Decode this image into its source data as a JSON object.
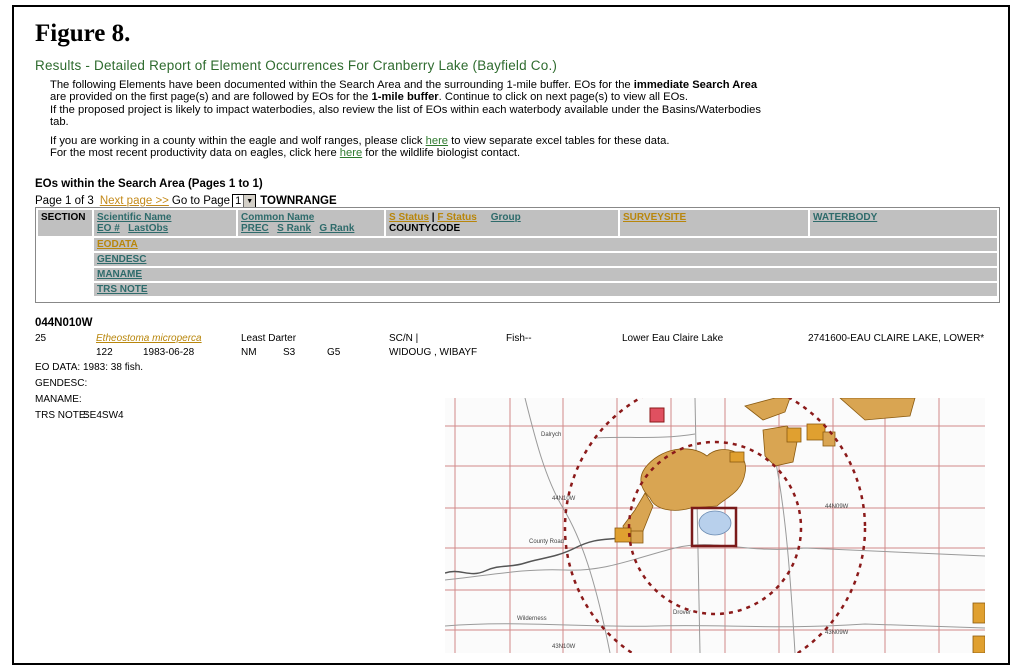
{
  "figure_title": "Figure 8.",
  "results_title": "Results - Detailed Report of Element Occurrences For Cranberry Lake (Bayfield Co.)",
  "intro": {
    "p1a": "The following Elements have been documented within the Search Area and the surrounding 1-mile buffer.   EOs for the ",
    "p1b": "immediate Search Area",
    "p2a": "are provided on the first page(s) and are followed by EOs for the ",
    "p2b": "1-mile buffer",
    "p2c": ". Continue to click on next page(s) to view all EOs.",
    "p3": "If the proposed project is likely to impact waterbodies, also review the list of EOs within each waterbody available under the Basins/Waterbodies",
    "p3b": "tab.",
    "p4a": "If you are working in a county within the eagle and wolf ranges, please click ",
    "p4_link": "here",
    "p4b": " to view separate excel tables for these data.",
    "p5a": "For the most recent productivity data on eagles, click here ",
    "p5_link": "here",
    "p5b": " for the wildlife biologist contact."
  },
  "eos_heading": "EOs within the Search Area (Pages 1 to 1)",
  "pager": {
    "page_of": "Page 1 of 3",
    "next": "Next page >>",
    "goto": "Go to Page",
    "selected": "1",
    "townrange": "TOWNRANGE"
  },
  "header": {
    "section": "SECTION",
    "sci_name": "Scientific Name",
    "eo_num": "EO #",
    "last_obs": "LastObs",
    "common_name": "Common Name",
    "prec": "PREC",
    "s_rank": "S Rank",
    "g_rank": "G Rank",
    "s_status": "S Status",
    "f_status": "F Status",
    "sep": " | ",
    "group": "Group",
    "countycode": "COUNTYCODE",
    "surveysite": "SURVEYSITE",
    "waterbody": "WATERBODY",
    "eodata": "EODATA",
    "gendesc": "GENDESC",
    "maname": "MANAME",
    "trs_note": "TRS NOTE"
  },
  "record": {
    "townrange": "044N010W",
    "section": "25",
    "sci_name": "Etheostoma microperca",
    "common_name": "Least Darter",
    "status": "SC/N |",
    "group": "Fish--",
    "surveysite": "Lower Eau Claire Lake",
    "waterbody": "2741600-EAU CLAIRE LAKE, LOWER*",
    "eo_num": "122",
    "last_obs": "1983-06-28",
    "prec": "NM",
    "s_rank": "S3",
    "g_rank": "G5",
    "countycode": "WIDOUG , WIBAYF",
    "eodata_label": "EO DATA:",
    "eodata": "1983: 38 fish.",
    "gendesc_label": "GENDESC:",
    "maname_label": "MANAME:",
    "trs_note_label": "TRS NOTE:",
    "trs_note": "SE4SW4"
  },
  "map": {
    "labels": [
      "44N10W",
      "44N09W",
      "43N10W",
      "43N09W",
      "County Road",
      "Wilderness",
      "Dalrych",
      "Drover"
    ],
    "colors": {
      "public_land": "#d9a552",
      "public_land_dark": "#e0a030",
      "lake": "#b8d0ec",
      "buffer": "#8b1a1a",
      "grid": "#d28a8a"
    }
  }
}
